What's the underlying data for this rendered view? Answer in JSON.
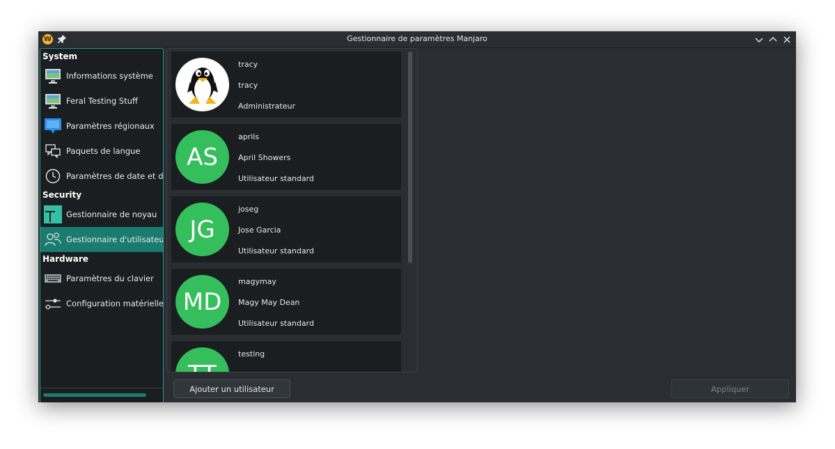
{
  "window": {
    "title": "Gestionnaire de paramètres Manjaro"
  },
  "sidebar": {
    "sections": [
      {
        "header": "System",
        "items": [
          {
            "label": "Informations système",
            "icon": "monitor-icon"
          },
          {
            "label": "Feral Testing Stuff",
            "icon": "monitor-icon"
          },
          {
            "label": "Paramètres régionaux",
            "icon": "chat-bubble-icon"
          },
          {
            "label": "Paquets de langue",
            "icon": "translate-icon"
          },
          {
            "label": "Paramètres de date et d'heure",
            "icon": "clock-icon"
          }
        ]
      },
      {
        "header": "Security",
        "items": [
          {
            "label": "Gestionnaire de noyau",
            "icon": "manjaro-logo-icon"
          },
          {
            "label": "Gestionnaire d'utilisateurs",
            "icon": "users-icon",
            "active": true
          }
        ]
      },
      {
        "header": "Hardware",
        "items": [
          {
            "label": "Paramètres du clavier",
            "icon": "keyboard-icon"
          },
          {
            "label": "Configuration matérielle",
            "icon": "sliders-icon"
          }
        ]
      }
    ]
  },
  "users": [
    {
      "username": "tracy",
      "fullname": "tracy",
      "role": "Administrateur",
      "avatar": "tux-icon"
    },
    {
      "username": "aprils",
      "fullname": "April Showers",
      "role": "Utilisateur standard",
      "initials": "AS"
    },
    {
      "username": "joseg",
      "fullname": "Jose Garcia",
      "role": "Utilisateur standard",
      "initials": "JG"
    },
    {
      "username": "magymay",
      "fullname": "Magy May Dean",
      "role": "Utilisateur standard",
      "initials": "MD"
    },
    {
      "username": "testing",
      "initials": "TT"
    }
  ],
  "buttons": {
    "add_user": "Ajouter un utilisateur",
    "apply": "Appliquer"
  },
  "colors": {
    "accent": "#1a7b6e",
    "avatar_green": "#35bf5c",
    "window_bg": "#2a2e32"
  }
}
